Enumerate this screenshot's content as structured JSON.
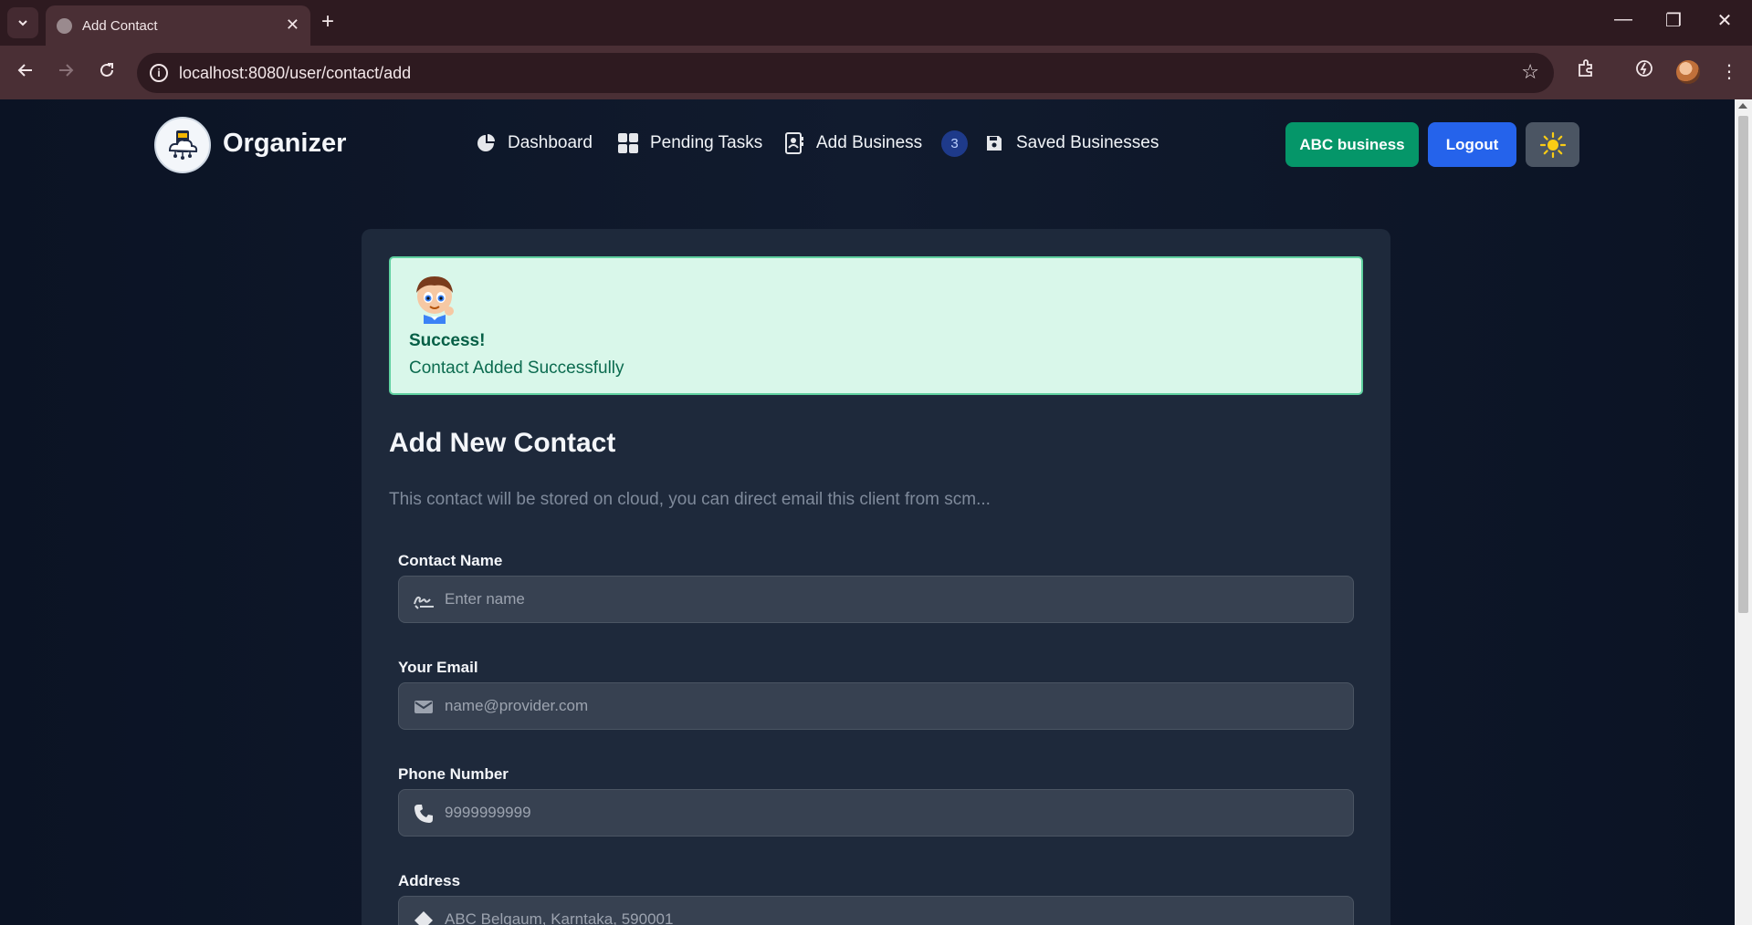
{
  "browser": {
    "tab_title": "Add Contact",
    "tab_close": "✕",
    "new_tab": "+",
    "url": "localhost:8080/user/contact/add",
    "window_controls": {
      "minimize": "—",
      "restore": "❐",
      "close": "✕"
    }
  },
  "navbar": {
    "brand": "Organizer",
    "items": [
      {
        "label": "Dashboard",
        "icon": "pie-chart-icon"
      },
      {
        "label": "Pending Tasks",
        "icon": "grid-icon"
      },
      {
        "label": "Add Business",
        "icon": "contact-book-icon"
      },
      {
        "label": "Saved Businesses",
        "icon": "floppy-disk-icon"
      }
    ],
    "badge_count": "3",
    "business_button": "ABC business",
    "logout_button": "Logout",
    "theme_icon": "sun-icon"
  },
  "alert": {
    "title": "Success!",
    "message": "Contact Added Successfully"
  },
  "form": {
    "title": "Add New Contact",
    "subtitle": "This contact will be stored on cloud, you can direct email this client from scm...",
    "fields": [
      {
        "label": "Contact Name",
        "placeholder": "Enter name",
        "icon": "signature-icon"
      },
      {
        "label": "Your Email",
        "placeholder": "name@provider.com",
        "icon": "envelope-icon"
      },
      {
        "label": "Phone Number",
        "placeholder": "9999999999",
        "icon": "phone-icon"
      },
      {
        "label": "Address",
        "placeholder": "ABC Belgaum, Karntaka, 590001",
        "icon": "location-icon"
      }
    ]
  },
  "colors": {
    "primary": "#2563eb",
    "success": "#059669",
    "card": "#1e293b",
    "background": "#0b1324"
  }
}
